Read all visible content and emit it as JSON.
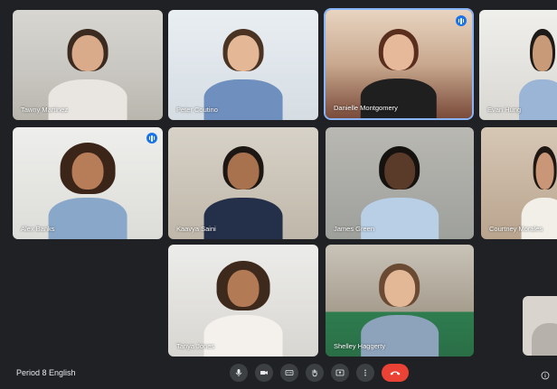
{
  "meeting": {
    "title": "Period 8 English"
  },
  "participants": [
    {
      "name": "Tawny Martinez",
      "speaking": false
    },
    {
      "name": "Peter Coutino",
      "speaking": false
    },
    {
      "name": "Danielle Montgomery",
      "speaking": true
    },
    {
      "name": "Evan Hung",
      "speaking": false
    },
    {
      "name": "Alex Banks",
      "speaking": true
    },
    {
      "name": "Kaavya Saini",
      "speaking": false
    },
    {
      "name": "James Green",
      "speaking": false
    },
    {
      "name": "Courtney Morales",
      "speaking": false
    },
    {
      "name": "Tanya Jones",
      "speaking": false
    },
    {
      "name": "Shelley Haggerty",
      "speaking": false
    }
  ],
  "controls": [
    {
      "icon": "microphone-icon"
    },
    {
      "icon": "camera-icon"
    },
    {
      "icon": "captions-icon"
    },
    {
      "icon": "raise-hand-icon"
    },
    {
      "icon": "present-screen-icon"
    },
    {
      "icon": "more-options-icon"
    },
    {
      "icon": "end-call-icon"
    }
  ],
  "colors": {
    "background": "#202124",
    "tile": "#3c4043",
    "active_border": "#8ab4f8",
    "speaking": "#1a73e8",
    "end_call": "#ea4335"
  }
}
